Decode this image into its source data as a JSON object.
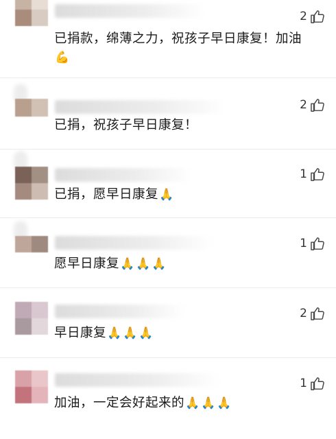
{
  "comments": [
    {
      "text": "已捐款，绵薄之力，祝孩子早日康复！加油",
      "emoji": "💪",
      "likes": "2",
      "avatar": [
        "#c7b3a4",
        "#e8ddd5",
        "#a98c7b",
        "#d8cbc2"
      ]
    },
    {
      "text": "已捐，祝孩子早日康复！",
      "emoji": "",
      "likes": "2",
      "avatar": [
        "#b9a08e",
        "#d1c1b4",
        "#e4dad2",
        "#f0ebe7"
      ]
    },
    {
      "text": "已捐，愿早日康复",
      "emoji": "🙏",
      "likes": "1",
      "avatar": [
        "#7a6258",
        "#a39085",
        "#a48a7f",
        "#cdbcb2"
      ]
    },
    {
      "text": "愿早日康复",
      "emoji": "🙏🙏🙏",
      "likes": "1",
      "avatar": [
        "#bfa69b",
        "#9f8a80",
        "#e3d8d2",
        "#ebe4df"
      ]
    },
    {
      "text": "早日康复",
      "emoji": "🙏🙏🙏",
      "likes": "2",
      "avatar": [
        "#c0aab5",
        "#d9c8cf",
        "#a99aa0",
        "#e2d7db"
      ]
    },
    {
      "text": "加油，一定会好起来的",
      "emoji": "🙏🙏🙏",
      "likes": "1",
      "avatar": [
        "#d8a2a8",
        "#e9c6c9",
        "#c2737c",
        "#e3b5ba"
      ]
    }
  ],
  "icons": {
    "like": "thumbs-up-icon"
  }
}
